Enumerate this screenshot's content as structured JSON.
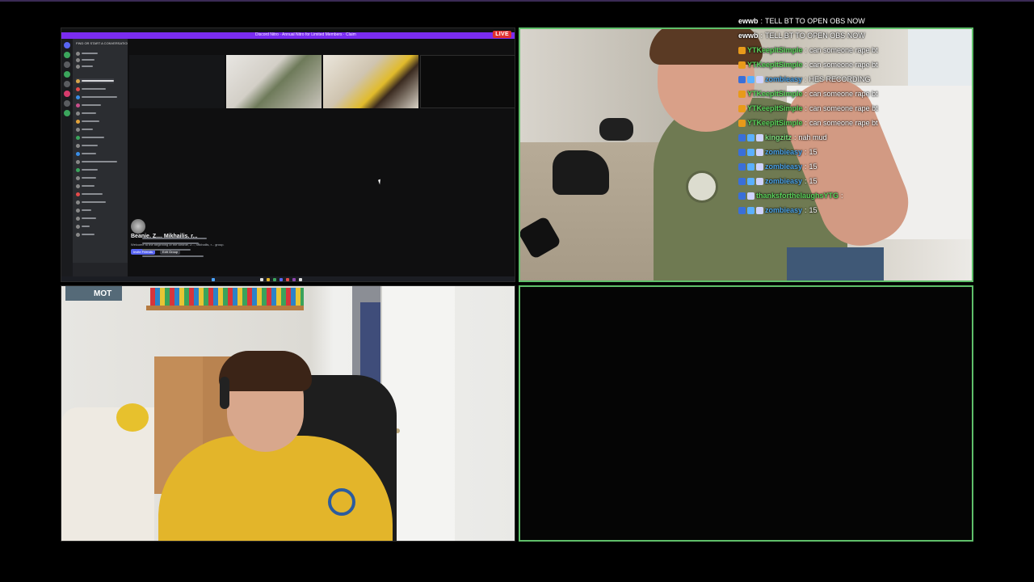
{
  "screen_share": {
    "banner_text": "Discord Nitro · Annual Nitro for Limited Members · Claim",
    "live_label": "LIVE",
    "sidebar_title": "FIND OR START A CONVERSATION",
    "group_name": "Beanie, Z..., Mikhailis, r...",
    "group_sub": "Welcome to the beginning of the Beanie, Z..., Mikhailis, r... group.",
    "invite_label": "Invite Friends",
    "edit_label": "Edit Group"
  },
  "chat": [
    {
      "user": "ewwb",
      "color": "#ffffff",
      "sep": ":",
      "text": "TELL BT TO OPEN OBS NOW",
      "badges": []
    },
    {
      "user": "ewwb",
      "color": "#ffffff",
      "sep": ":",
      "text": "TELL BT TO OPEN OBS NOW",
      "badges": []
    },
    {
      "user": "YTKeepItSimple",
      "color": "#5cd65c",
      "sep": ":",
      "text": "can someone rape bt",
      "badges": [
        "#e89a1a"
      ]
    },
    {
      "user": "YTKeepItSimple",
      "color": "#5cd65c",
      "sep": ":",
      "text": "can someone rape bt",
      "badges": [
        "#e89a1a"
      ]
    },
    {
      "user": "zombieasy",
      "color": "#4aa3e8",
      "sep": ":",
      "text": "HES RECORDING",
      "badges": [
        "#3a6fd8",
        "#5ab0ff",
        "#cfd4ff"
      ]
    },
    {
      "user": "YTKeepItSimple",
      "color": "#5cd65c",
      "sep": ":",
      "text": "can someone rape bt",
      "badges": [
        "#e89a1a"
      ]
    },
    {
      "user": "YTKeepItSimple",
      "color": "#5cd65c",
      "sep": ":",
      "text": "can someone rape bt",
      "badges": [
        "#e89a1a"
      ]
    },
    {
      "user": "YTKeepItSimple",
      "color": "#5cd65c",
      "sep": ":",
      "text": "can someone rape bt",
      "badges": [
        "#e89a1a"
      ]
    },
    {
      "user": "kingzitz",
      "color": "#7ee07e",
      "sep": ":",
      "text": "nah mud",
      "badges": [
        "#3a6fd8",
        "#5ab0ff",
        "#cfd4ff"
      ]
    },
    {
      "user": "zombieasy",
      "color": "#4aa3e8",
      "sep": ":",
      "text": "15",
      "badges": [
        "#3a6fd8",
        "#5ab0ff",
        "#cfd4ff"
      ]
    },
    {
      "user": "zombieasy",
      "color": "#4aa3e8",
      "sep": ":",
      "text": "15",
      "badges": [
        "#3a6fd8",
        "#5ab0ff",
        "#cfd4ff"
      ]
    },
    {
      "user": "zombieasy",
      "color": "#4aa3e8",
      "sep": ":",
      "text": "15",
      "badges": [
        "#3a6fd8",
        "#5ab0ff",
        "#cfd4ff"
      ]
    },
    {
      "user": "thanksforthelaughsYTG",
      "color": "#5cd65c",
      "sep": ":",
      "text": "",
      "badges": [
        "#3a6fd8",
        "#cfd4ff"
      ]
    },
    {
      "user": "zombieasy",
      "color": "#4aa3e8",
      "sep": ":",
      "text": "15",
      "badges": [
        "#3a6fd8",
        "#5ab0ff",
        "#cfd4ff"
      ]
    }
  ],
  "cam2": {
    "poster_text": "MOT"
  },
  "colors": {
    "tile_border": "#5fbf6a",
    "live_red": "#e0302f",
    "nitro_purple": "#7a2cf0"
  }
}
